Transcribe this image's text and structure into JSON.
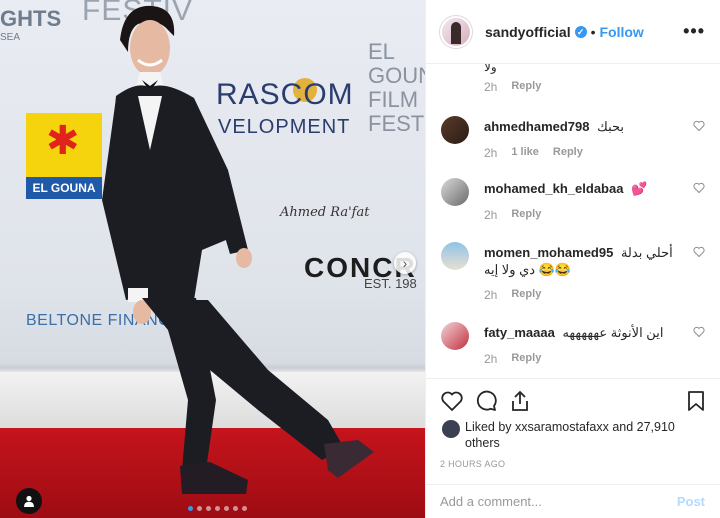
{
  "photo": {
    "sponsors": {
      "festival_top": "FESTIV",
      "ghts": "GHTS",
      "sea": "SEA",
      "rascom": "RASCOM",
      "development": "VELOPMENT",
      "elgouna_film": "EL GOUNA FILM FESTI",
      "concr": "CONCR",
      "est": "EST. 198",
      "beltone": "BELTONE FINANCE",
      "elgouna_logo": "EL GOUNA"
    },
    "signature": "Ahmed Ra'fat",
    "carousel_count": 7,
    "carousel_active": 0
  },
  "post": {
    "username": "sandyofficial",
    "follow_label": "Follow",
    "bullet": "•",
    "more_label": "•••"
  },
  "comments": {
    "first_meta": {
      "time": "2h",
      "reply": "Reply"
    },
    "items": [
      {
        "username": "ahmedhamed798",
        "text": "بحبك",
        "time": "2h",
        "likes": "1 like",
        "reply": "Reply"
      },
      {
        "username": "mohamed_kh_eldabaa",
        "text": "💕",
        "time": "2h",
        "likes": "",
        "reply": "Reply"
      },
      {
        "username": "momen_mohamed95",
        "text": "أحلي بدلة دي ولا إيه 😂😂",
        "time": "2h",
        "likes": "",
        "reply": "Reply"
      },
      {
        "username": "faty_maaaa",
        "text": "اين الأنوثة عهههههه",
        "time": "2h",
        "likes": "",
        "reply": "Reply"
      }
    ]
  },
  "likes": {
    "prefix": "Liked by",
    "user": "xxsaramostafaxx",
    "and": "and",
    "count": "27,910 others"
  },
  "timestamp": "2 HOURS AGO",
  "add_comment": {
    "placeholder": "Add a comment...",
    "post_label": "Post"
  },
  "colors": {
    "accent": "#3897f0",
    "carpet": "#c0111a",
    "post_disabled": "#b3dbff"
  }
}
